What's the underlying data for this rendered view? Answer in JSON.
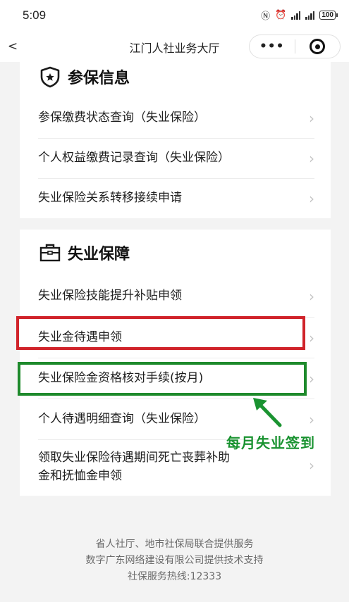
{
  "status_bar": {
    "time": "5:09",
    "battery": "100"
  },
  "nav": {
    "title": "江门人社业务大厅",
    "more": "•••"
  },
  "section1": {
    "title": "参保信息",
    "items": [
      {
        "label": "参保缴费状态查询（失业保险）"
      },
      {
        "label": "个人权益缴费记录查询（失业保险）"
      },
      {
        "label": "失业保险关系转移接续申请"
      }
    ]
  },
  "section2": {
    "title": "失业保障",
    "items": [
      {
        "label": "失业保险技能提升补贴申领"
      },
      {
        "label": "失业金待遇申领"
      },
      {
        "label": "失业保险金资格核对手续(按月)"
      },
      {
        "label": "个人待遇明细查询（失业保险）"
      },
      {
        "label_line1": "领取失业保险待遇期间死亡丧葬补助",
        "label_line2": "金和抚恤金申领"
      }
    ]
  },
  "annotation": {
    "text": "每月失业签到",
    "red_color": "#d0232a",
    "green_color": "#1e8a2c"
  },
  "footer": {
    "line1": "省人社厅、地市社保局联合提供服务",
    "line2": "数字广东网络建设有限公司提供技术支持",
    "line3": "社保服务热线:12333"
  },
  "icons": {
    "chevron": "›"
  }
}
